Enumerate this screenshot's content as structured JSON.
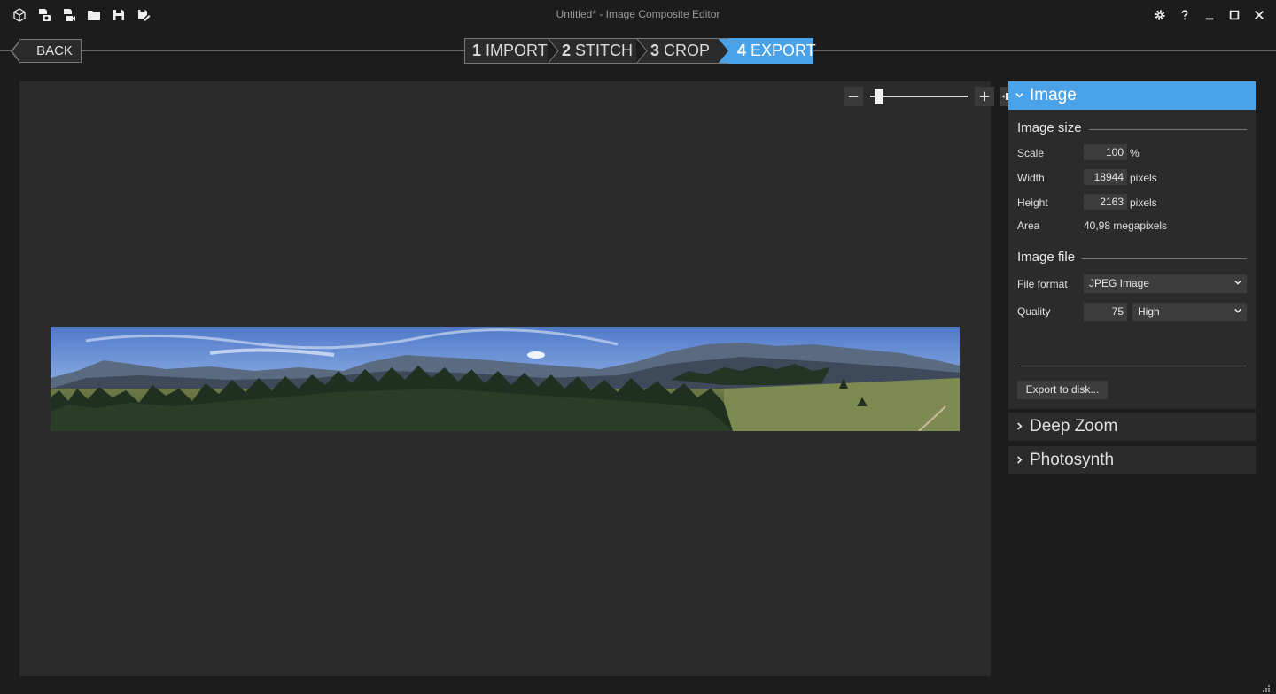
{
  "window": {
    "title": "Untitled* - Image Composite Editor"
  },
  "toolbar_icons": [
    "new-project-icon",
    "new-panorama-from-images-icon",
    "new-panorama-from-video-icon",
    "open-folder-icon",
    "save-icon",
    "save-as-icon"
  ],
  "window_controls": [
    "settings-icon",
    "help-icon",
    "minimize-icon",
    "maximize-icon",
    "close-icon"
  ],
  "nav": {
    "back_label": "BACK",
    "steps": [
      {
        "num": "1",
        "label": "IMPORT",
        "active": false
      },
      {
        "num": "2",
        "label": "STITCH",
        "active": false
      },
      {
        "num": "3",
        "label": "CROP",
        "active": false
      },
      {
        "num": "4",
        "label": "EXPORT",
        "active": true
      }
    ]
  },
  "zoom": {
    "level": 0.05
  },
  "colors": {
    "accent": "#4aa3e8",
    "panel": "#2b2b2b",
    "background": "#1c1c1c"
  },
  "panel": {
    "image_header": "Image",
    "image_size_title": "Image size",
    "scale_label": "Scale",
    "scale_value": "100",
    "scale_unit": "%",
    "width_label": "Width",
    "width_value": "18944",
    "width_unit": "pixels",
    "height_label": "Height",
    "height_value": "2163",
    "height_unit": "pixels",
    "area_label": "Area",
    "area_value": "40,98 megapixels",
    "image_file_title": "Image file",
    "file_format_label": "File format",
    "file_format_value": "JPEG Image",
    "quality_label": "Quality",
    "quality_value": "75",
    "quality_level": "High",
    "export_button": "Export to disk...",
    "deep_zoom_header": "Deep Zoom",
    "photosynth_header": "Photosynth"
  }
}
